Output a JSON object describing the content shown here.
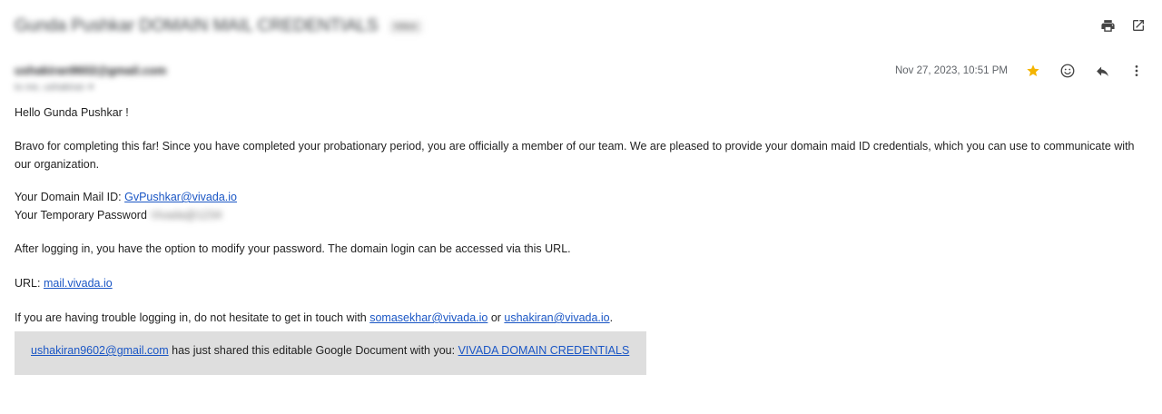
{
  "header": {
    "subject": "Gunda Pushkar DOMAIN MAIL CREDENTIALS",
    "label_chip": "Inbox",
    "print_icon": "print-icon",
    "open_new_icon": "open-in-new-window-icon"
  },
  "message": {
    "sender_email": "ushakiran9602@gmail.com",
    "to_line": "to me, ushakiran",
    "date": "Nov 27, 2023, 10:51 PM",
    "icons": [
      "star-icon",
      "emoji-icon",
      "reply-icon",
      "more-vert-icon"
    ],
    "colors": {
      "star": "#f4b400",
      "link": "#1a56c5",
      "share_box": "#dedede"
    }
  },
  "body": {
    "greeting": "Hello Gunda Pushkar !",
    "paragraph1_line1": "Bravo for completing this far! Since you have completed your probationary period, you are officially a member of our team. We are pleased to provide your domain maid ID credentials, which you can use to communicate with",
    "paragraph1_line2": "our organization.",
    "mail_id_label": "Your Domain Mail ID: ",
    "mail_id_link": "GvPushkar@vivada.io",
    "password_label": "Your Temporary Password",
    "password_value": "Vivada@1234",
    "paragraph2": "After logging in, you have the option to modify your password. The domain login can be accessed via this URL.",
    "url_label": "URL: ",
    "url_link": "mail.vivada.io",
    "trouble_prefix": "If you are having trouble logging in, do not hesitate to get in touch with ",
    "trouble_link1": "somasekhar@vivada.io",
    "trouble_or": " or ",
    "trouble_link2": "ushakiran@vivada.io",
    "trouble_suffix": "."
  },
  "share": {
    "sharer_link": "ushakiran9602@gmail.com",
    "share_text": " has just shared this editable Google Document with you: ",
    "doc_link": "VIVADA DOMAIN CREDENTIALS"
  }
}
